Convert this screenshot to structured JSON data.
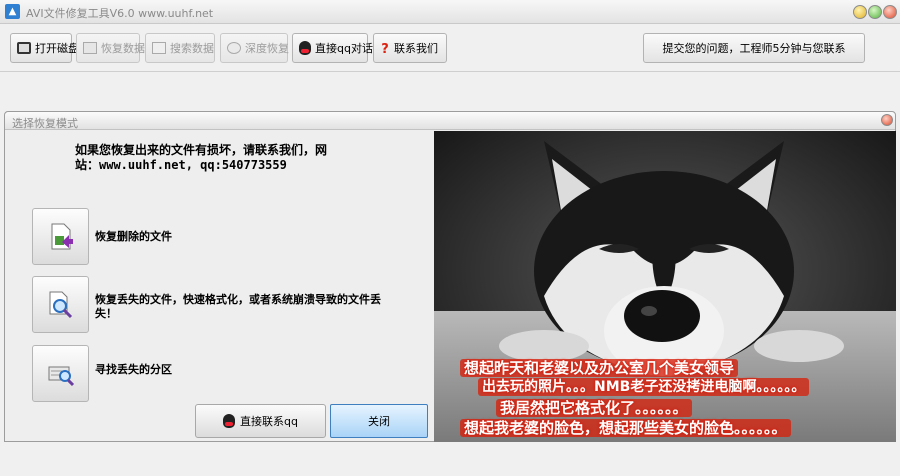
{
  "window": {
    "title": "AVI文件修复工具V6.0 www.uuhf.net",
    "icon": "app-logo-icon"
  },
  "toolbar": {
    "buttons": [
      {
        "label": "打开磁盘",
        "icon": "disk-icon",
        "enabled": true
      },
      {
        "label": "恢复数据",
        "icon": "recover-icon",
        "enabled": false
      },
      {
        "label": "搜索数据",
        "icon": "search-data-icon",
        "enabled": false
      },
      {
        "label": "深度恢复",
        "icon": "deep-recover-icon",
        "enabled": false
      },
      {
        "label": "直接qq对话",
        "icon": "qq-icon",
        "enabled": true
      },
      {
        "label": "联系我们",
        "icon": "help-icon",
        "enabled": true
      }
    ],
    "submit_label": "提交您的问题，工程师5分钟与您联系"
  },
  "dialog": {
    "title": "选择恢复模式",
    "notice_line1": "如果您恢复出来的文件有损坏，请联系我们，网",
    "notice_line2": "站：www.uuhf.net, qq:540773559",
    "options": [
      {
        "label": "恢复删除的文件",
        "icon": "restore-deleted-icon"
      },
      {
        "label": "恢复丢失的文件，快速格式化，或者系统崩溃导致的文件丢失！",
        "icon": "find-lost-files-icon"
      },
      {
        "label": "寻找丢失的分区",
        "icon": "find-partition-icon"
      }
    ],
    "qq_button_label": "直接联系qq",
    "close_button_label": "关闭",
    "image_caption": [
      "想起昨天和老婆以及办公室几个美女领导",
      "出去玩的照片。。。NMB老子还没拷进电脑啊。。。。。。",
      "我居然把它格式化了。。。。。。",
      "想起我老婆的脸色，想起那些美女的脸色。。。。。。"
    ]
  },
  "colors": {
    "caption_bg": "#d6220e",
    "close_button": "#a9d3f7"
  }
}
